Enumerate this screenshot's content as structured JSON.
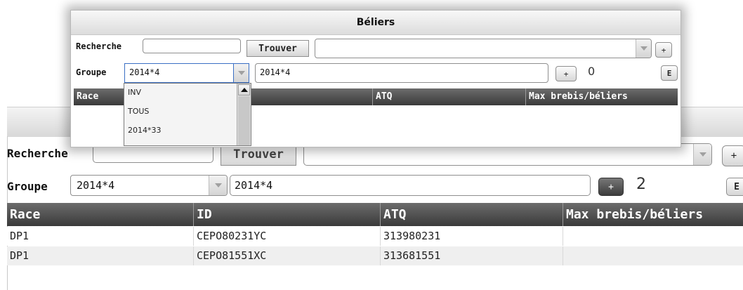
{
  "back_window": {
    "search_label": "Recherche",
    "search_value": "",
    "find_button": "Trouver",
    "search_result_value": "",
    "add_button_1": "+",
    "group_label": "Groupe",
    "group_select_value": "2014*4",
    "group_name_value": "2014*4",
    "add_button_2": "+",
    "group_count": "2",
    "edit_button": "E",
    "table": {
      "columns": [
        "Race",
        "ID",
        "ATQ",
        "Max brebis/béliers"
      ],
      "rows": [
        [
          "DP1",
          "CEPO80231YC",
          "313980231",
          ""
        ],
        [
          "DP1",
          "CEPO81551XC",
          "313681551",
          ""
        ]
      ]
    }
  },
  "front_window": {
    "title": "Béliers",
    "search_label": "Recherche",
    "search_value": "",
    "find_button": "Trouver",
    "search_result_value": "",
    "add_button_1": "+",
    "group_label": "Groupe",
    "group_select_value": "2014*4",
    "group_name_value": "2014*4",
    "add_button_2": "+",
    "group_count": "0",
    "edit_button": "E",
    "table": {
      "columns": [
        "Race",
        "",
        "ATQ",
        "Max brebis/béliers"
      ]
    },
    "dropdown_options": [
      "INV",
      "TOUS",
      "2014*33"
    ]
  },
  "colors": {
    "header_dark": "#3a3a3a",
    "row_alt": "#efefef",
    "field_border": "#8f8f8f"
  }
}
